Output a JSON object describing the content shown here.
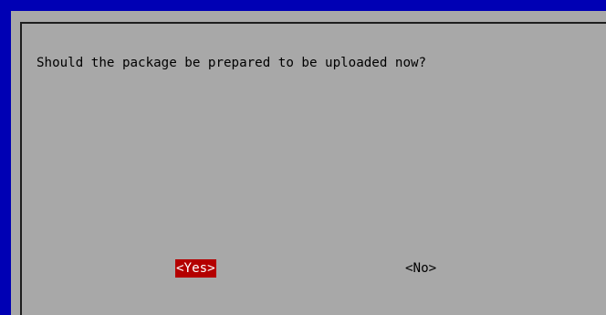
{
  "dialog": {
    "message": "Should the package be prepared to be uploaded now?",
    "buttons": {
      "yes_label": "<Yes>",
      "no_label": "<No>"
    }
  },
  "colors": {
    "screen_background": "#0000b4",
    "dialog_background": "#a8a8a8",
    "selected_button_bg": "#b40000",
    "selected_button_fg": "#ffffff",
    "text": "#000000"
  }
}
